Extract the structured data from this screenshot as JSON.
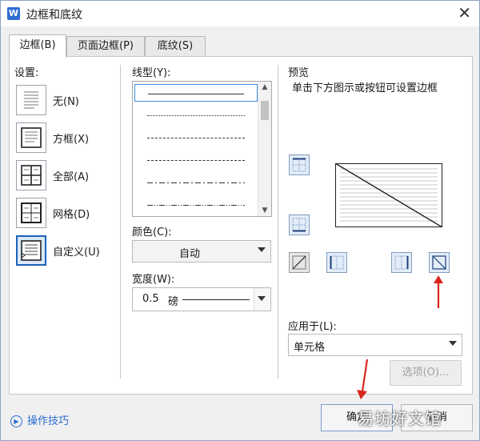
{
  "window": {
    "title": "边框和底纹",
    "app_icon_letter": "W",
    "close_glyph": "✕"
  },
  "tabs": [
    {
      "label": "边框(B)",
      "active": true
    },
    {
      "label": "页面边框(P)",
      "active": false
    },
    {
      "label": "底纹(S)",
      "active": false
    }
  ],
  "settings": {
    "heading": "设置:",
    "items": [
      {
        "label": "无(N)",
        "icon": "settings-none-icon"
      },
      {
        "label": "方框(X)",
        "icon": "settings-box-icon"
      },
      {
        "label": "全部(A)",
        "icon": "settings-all-icon"
      },
      {
        "label": "网格(D)",
        "icon": "settings-grid-icon"
      },
      {
        "label": "自定义(U)",
        "icon": "settings-custom-icon",
        "selected": true
      }
    ]
  },
  "line_style": {
    "heading": "线型(Y):",
    "styles": [
      "solid",
      "dotted",
      "dashed-small",
      "dashed",
      "dash-dot",
      "dash-dot-dot"
    ]
  },
  "color": {
    "heading": "颜色(C):",
    "value": "自动"
  },
  "width": {
    "heading": "宽度(W):",
    "value": "0.5",
    "unit": "磅"
  },
  "preview": {
    "heading": "预览",
    "hint": "单击下方图示或按钮可设置边框"
  },
  "apply_to": {
    "heading": "应用于(L):",
    "value": "单元格"
  },
  "buttons": {
    "options": "选项(O)...",
    "ok": "确定",
    "cancel": "取消"
  },
  "footer": {
    "tips": "操作技巧",
    "watermark": "易坊好文馆"
  },
  "colors": {
    "accent": "#1c62b9",
    "link": "#2a6ad0",
    "arrow": "#d9261c"
  }
}
